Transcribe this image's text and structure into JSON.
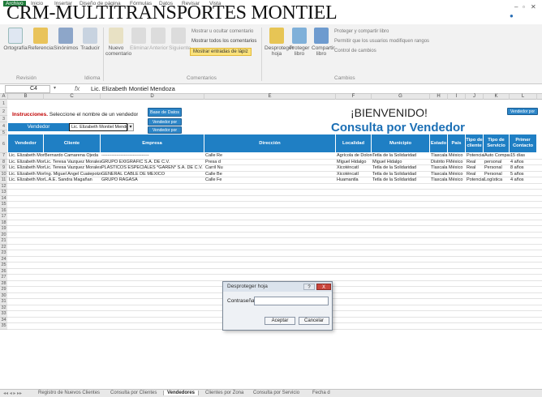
{
  "window": {
    "title": "CRM-MULTITRANSPORTES MONTIEL"
  },
  "menu": {
    "items": [
      "Archivo",
      "Inicio",
      "Insertar",
      "Diseño de página",
      "Fórmulas",
      "Datos",
      "Revisar",
      "Vista"
    ]
  },
  "ribbon": {
    "buttons": [
      "Ortografía",
      "Referencia",
      "Sinónimos",
      "Traducir",
      "Nuevo comentario",
      "Eliminar",
      "Anterior",
      "Siguiente",
      "Desproteger hoja",
      "Proteger libro",
      "Compartir libro"
    ],
    "small": [
      "Mostrar u ocultar comentario",
      "Mostrar todos los comentarios",
      "Mostrar entradas de lápiz",
      "Proteger y compartir libro",
      "Permitir que los usuarios modifiquen rangos",
      "Control de cambios"
    ],
    "groups": [
      "Revisión",
      "Idioma",
      "Comentarios",
      "Cambios"
    ]
  },
  "formula_bar": {
    "namebox": "C4",
    "fx": "fx",
    "value": "Lic. Elizabeth Montiel Mendoza"
  },
  "columns": [
    "A",
    "B",
    "C",
    "D",
    "E",
    "F",
    "G",
    "H",
    "I",
    "J",
    "K",
    "L"
  ],
  "rows": [
    "1",
    "2",
    "3",
    "4",
    "5",
    "6",
    "7",
    "8",
    "9",
    "10",
    "11",
    "12",
    "13",
    "14",
    "15",
    "16",
    "17",
    "18",
    "19",
    "20",
    "21",
    "22",
    "23",
    "24",
    "25",
    "26",
    "27",
    "28",
    "29",
    "30",
    "31",
    "32",
    "33",
    "34",
    "35"
  ],
  "sheet": {
    "instruction_bold": "Instrucciones.",
    "instruction_text": "Seleccione el nombre de un vendedor",
    "vendedor_label": "Vendedor",
    "vendedor_value": "Lic. Elizabeth Montiel Mendoza",
    "btn_base": "Base de Datos",
    "btn_vendedor": "Vendedor por Vendedor",
    "btn_zona": "Vendedor por Zona",
    "btn_top": "Vendedor por Ventas",
    "welcome": "¡BIENVENIDO!",
    "subtitle": "Consulta por Vendedor",
    "headers": [
      "Vendedor",
      "Cliente",
      "Empresa",
      "Dirección",
      "Localidad",
      "Municipio",
      "Estado",
      "País",
      "Tipo de cliente",
      "Tipo de Servicio",
      "Primer Contacto"
    ],
    "data": [
      [
        "Lic. Elizabeth Montiel Mendoza",
        "Bernardo Camarena Ojeda",
        "--------------------------------",
        "Calle Re",
        "Agrícola de Dolores",
        "Tetla de la Solidaridad",
        "Tlaxcala",
        "México",
        "Potencial",
        "Auto Compacto",
        "15 días"
      ],
      [
        "Lic. Elizabeth Montiel Mendoza",
        "Lic. Teresa Vazquez Morales",
        "GRUPO EXIGRAFIC S.A. DE C.V.",
        "Presa d",
        "Miguel Hidalgo",
        "Miguel Hidalgo",
        "Distrito Federal",
        "México",
        "Real",
        "personal",
        "4 años"
      ],
      [
        "Lic. Elizabeth Montiel Mendoza",
        "Lic. Teresa Vazquez Morales",
        "PLÁSTICOS ESPECIALES *GAREN* S.A. DE C.V.",
        "Carril Nu",
        "Xicoténcatl",
        "Tetla de la Solidaridad",
        "Tlaxcala",
        "México",
        "Real",
        "Personal",
        "8 años"
      ],
      [
        "Lic. Elizabeth Montiel Mendoza",
        "Ing. Miguel Angel Cuatepotzo",
        "GENERAL CABLE DE MÉXICO",
        "Calle Be",
        "Xicoténcatl",
        "Tetla de la Solidaridad",
        "Tlaxcala",
        "México",
        "Real",
        "Personal",
        "5 años"
      ],
      [
        "Lic. Elizabeth Montiel Mendoza",
        "L.A.E. Sandra Magañan",
        "GRUPO RAGASA",
        "Calle Fe",
        "Huamantla",
        "Tetla de la Solidaridad",
        "Tlaxcala",
        "México",
        "Potencial",
        "Logística",
        "4 años"
      ]
    ]
  },
  "dialog": {
    "title": "Desproteger hoja",
    "help": "?",
    "close": "X",
    "label": "Contraseña:",
    "ok": "Aceptar",
    "cancel": "Cancelar"
  },
  "sheet_tabs": [
    "Registro de Nuevos Clientes",
    "Consulta por Clientes",
    "Vendedores",
    "Clientes por Zona",
    "Consulta por Servicio",
    "Fecha d"
  ],
  "active_tab": "Vendedores",
  "colors": {
    "header_blue": "#1f7fc4",
    "title_blue": "#1b6fb5",
    "instruction_red": "#c00000"
  }
}
